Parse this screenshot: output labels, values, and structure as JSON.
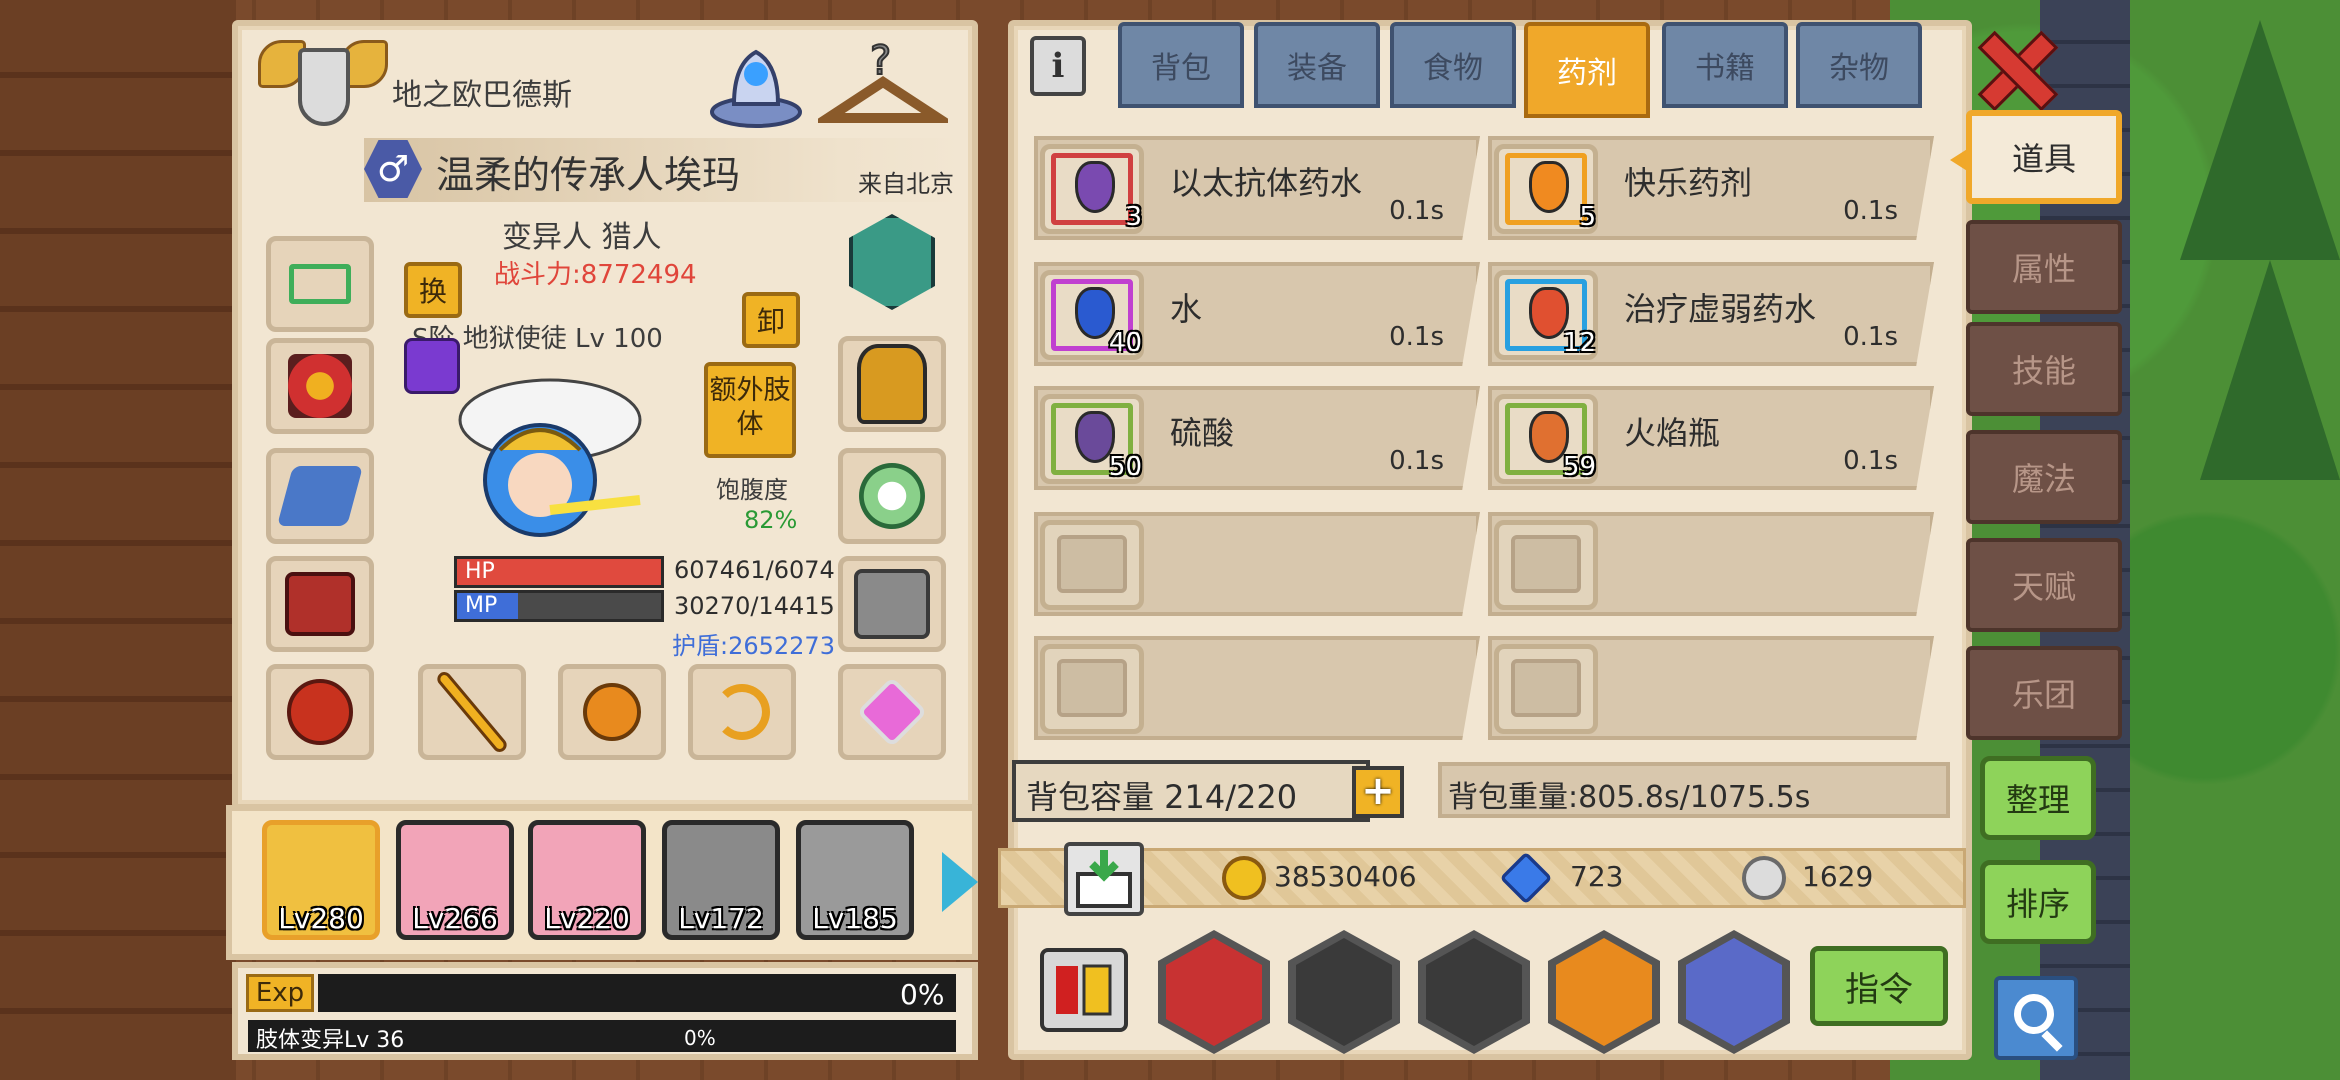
{
  "character": {
    "realm": "地之欧巴德斯",
    "gender_symbol": "♂",
    "name": "温柔的传承人埃玛",
    "origin": "来自北京",
    "race_class": "变异人 猎人",
    "power": "战斗力:8772494",
    "swap_label": "换",
    "unequip_label": "卸",
    "extra_limb_label": "额外肢体",
    "weapon_label": "S阶 地狱使徒 Lv 100",
    "satiety_label": "饱腹度",
    "satiety_value": "82%",
    "hp": {
      "tag": "HP",
      "value": "607461/6074",
      "fill": 1.0,
      "color": "#e04a3e"
    },
    "mp": {
      "tag": "MP",
      "value": "30270/14415",
      "fill": 0.3,
      "color": "#3f6ed8"
    },
    "shield": "护盾:2652273"
  },
  "team": [
    {
      "level": "Lv280",
      "active": true,
      "color": "#f0c040"
    },
    {
      "level": "Lv266",
      "active": false,
      "color": "#f2a4b8"
    },
    {
      "level": "Lv220",
      "active": false,
      "color": "#f2a4b8"
    },
    {
      "level": "Lv172",
      "active": false,
      "color": "#8a8a8a"
    },
    {
      "level": "Lv185",
      "active": false,
      "color": "#9a9a9a"
    }
  ],
  "exp": {
    "tag": "Exp",
    "percent": "0%",
    "mutation_label": "肢体变异Lv 36",
    "mutation_percent": "0%"
  },
  "tabs": [
    {
      "label": "背包",
      "active": false
    },
    {
      "label": "装备",
      "active": false
    },
    {
      "label": "食物",
      "active": false
    },
    {
      "label": "药剂",
      "active": true
    },
    {
      "label": "书籍",
      "active": false
    },
    {
      "label": "杂物",
      "active": false
    }
  ],
  "items": [
    {
      "name": "以太抗体药水",
      "weight": "0.1s",
      "count": "3",
      "border": "#d04040",
      "liquid": "#7a4ab0"
    },
    {
      "name": "快乐药剂",
      "weight": "0.1s",
      "count": "5",
      "border": "#f0a020",
      "liquid": "#f08a20"
    },
    {
      "name": "水",
      "weight": "0.1s",
      "count": "40",
      "border": "#c040d0",
      "liquid": "#2a5ad0"
    },
    {
      "name": "治疗虚弱药水",
      "weight": "0.1s",
      "count": "12",
      "border": "#28a0e0",
      "liquid": "#e05030"
    },
    {
      "name": "硫酸",
      "weight": "0.1s",
      "count": "50",
      "border": "#80b040",
      "liquid": "#6a4a9a"
    },
    {
      "name": "火焰瓶",
      "weight": "0.1s",
      "count": "59",
      "border": "#80b040",
      "liquid": "#e07030"
    }
  ],
  "inventory": {
    "capacity": "背包容量 214/220",
    "plus_label": "+",
    "weight": "背包重量:805.8s/1075.5s"
  },
  "currency": {
    "gold": "38530406",
    "gems": "723",
    "silver": "1629"
  },
  "buttons": {
    "command": "指令",
    "organize": "整理",
    "sort": "排序",
    "info": "i"
  },
  "side_tabs": [
    {
      "label": "道具",
      "active": true
    },
    {
      "label": "属性",
      "active": false
    },
    {
      "label": "技能",
      "active": false
    },
    {
      "label": "魔法",
      "active": false
    },
    {
      "label": "天赋",
      "active": false
    },
    {
      "label": "乐团",
      "active": false
    }
  ]
}
